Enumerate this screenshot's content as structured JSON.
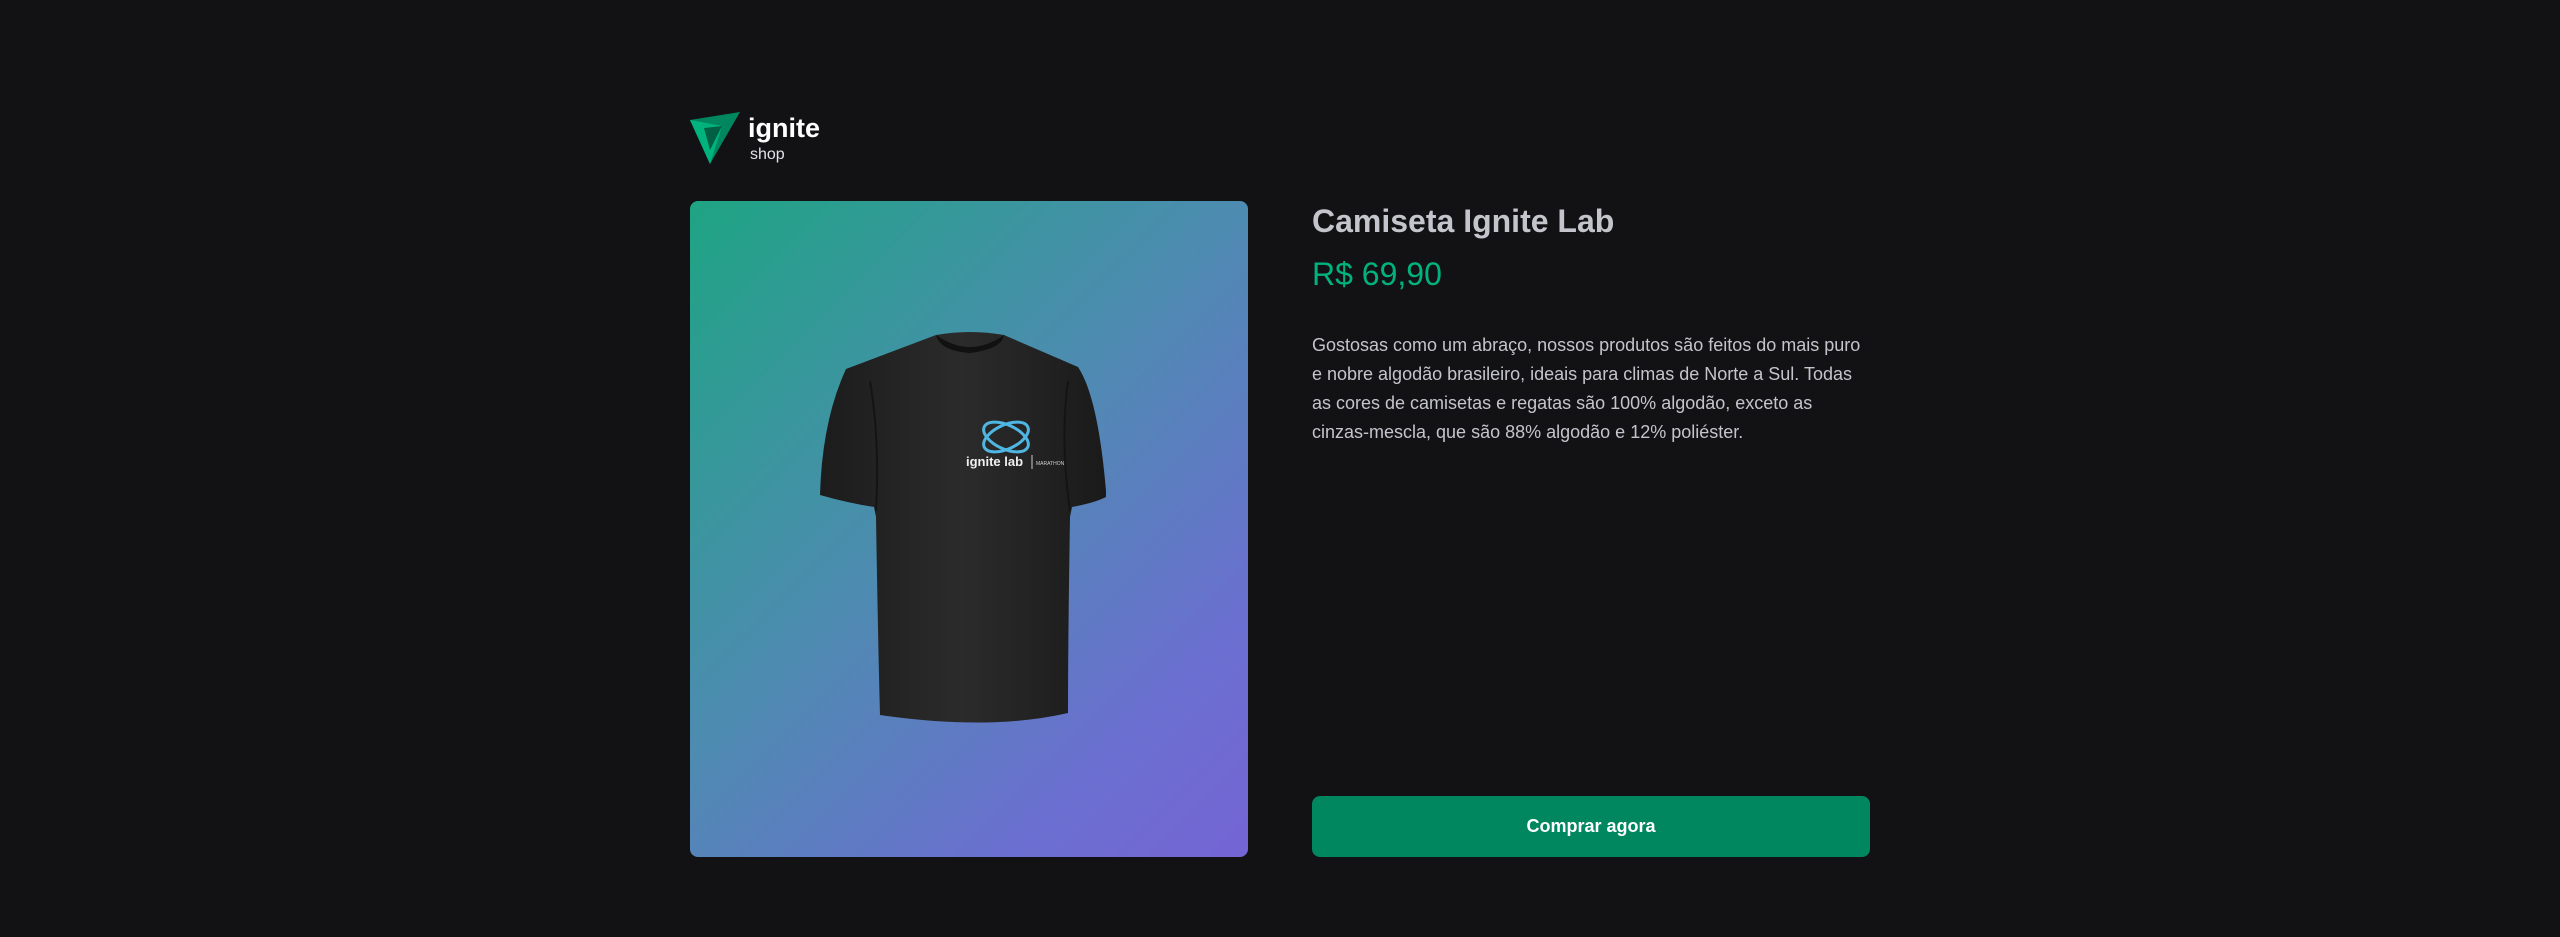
{
  "header": {
    "logo_icon": "ignite-triangle-logo-icon",
    "logo_title": "ignite",
    "logo_subtitle": "shop"
  },
  "product": {
    "image_icon": "tshirt-image",
    "shirt_print_title": "ignite lab",
    "shirt_print_sub": "MARATHON",
    "name": "Camiseta Ignite Lab",
    "price": "R$ 69,90",
    "description": "Gostosas como um abraço, nossos produtos são feitos do mais puro e nobre algodão brasileiro, ideais para climas de Norte a Sul. Todas as cores de camisetas e regatas são 100% algodão, exceto as cinzas-mescla, que são 88% algodão e 12% poliéster.",
    "buy_label": "Comprar agora"
  },
  "colors": {
    "background": "#121214",
    "accent": "#00875f",
    "price": "#00b37e",
    "gradient_start": "#1ea483",
    "gradient_end": "#7465d4"
  }
}
